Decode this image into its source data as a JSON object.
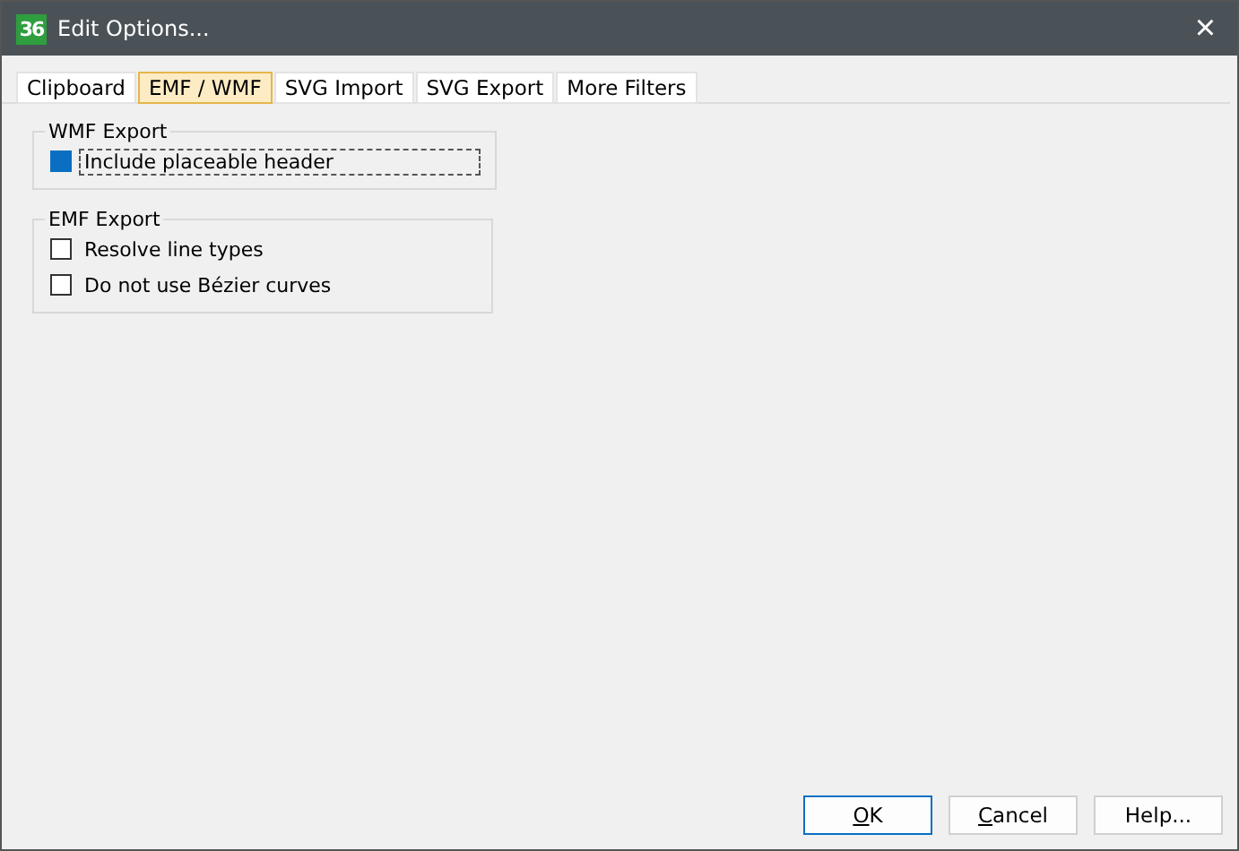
{
  "window": {
    "title": "Edit Options...",
    "logo": "36",
    "close": "×"
  },
  "tabs": [
    {
      "label": "Clipboard",
      "selected": false
    },
    {
      "label": "EMF / WMF",
      "selected": true
    },
    {
      "label": "SVG Import",
      "selected": false
    },
    {
      "label": "SVG Export",
      "selected": false
    },
    {
      "label": "More Filters",
      "selected": false
    }
  ],
  "groups": [
    {
      "title": "WMF Export",
      "options": [
        {
          "label": "Include placeable header",
          "checked": true,
          "focused": true
        }
      ]
    },
    {
      "title": "EMF Export",
      "options": [
        {
          "label": "Resolve line types",
          "checked": false,
          "focused": false
        },
        {
          "label": "Do not use Bézier curves",
          "checked": false,
          "focused": false
        }
      ]
    }
  ],
  "buttons": [
    {
      "accel": "O",
      "rest": "K",
      "default": true
    },
    {
      "accel": "C",
      "rest": "ancel",
      "default": false
    },
    {
      "rest": "Help...",
      "default": false
    }
  ]
}
